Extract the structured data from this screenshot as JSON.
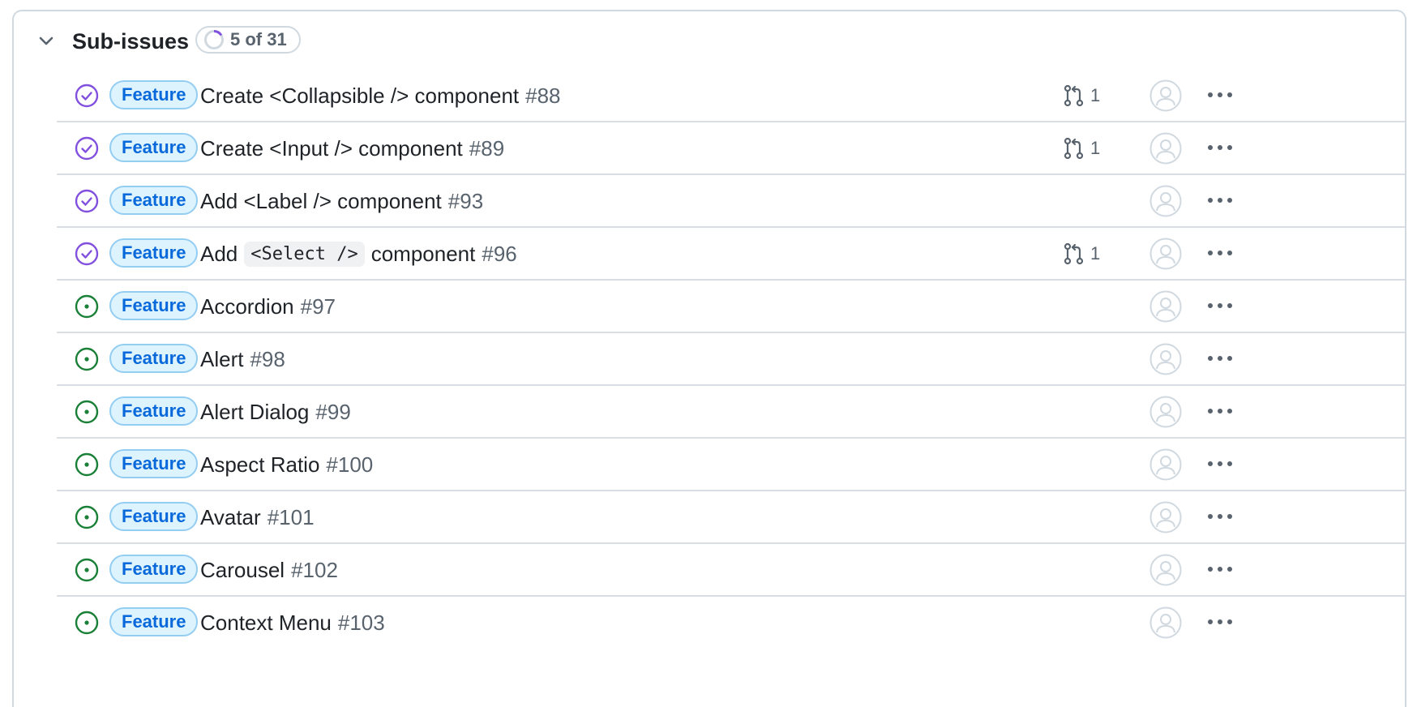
{
  "header": {
    "title": "Sub-issues",
    "progress": "5 of 31",
    "progress_completed": 5,
    "progress_total": 31
  },
  "colors": {
    "closed_purple": "#8250df",
    "open_green": "#1a7f37",
    "label_bg": "#ddf4ff",
    "label_text": "#0969da",
    "muted": "#59636e"
  },
  "rows": [
    {
      "state": "closed",
      "state_icon": "issue-closed-icon",
      "label": "Feature",
      "title": "Create <Collapsible /> component",
      "number": "#88",
      "pr_count": "1",
      "code": ""
    },
    {
      "state": "closed",
      "state_icon": "issue-closed-icon",
      "label": "Feature",
      "title": "Create <Input /> component",
      "number": "#89",
      "pr_count": "1",
      "code": ""
    },
    {
      "state": "closed",
      "state_icon": "issue-closed-icon",
      "label": "Feature",
      "title": "Add <Label /> component",
      "number": "#93",
      "pr_count": "",
      "code": ""
    },
    {
      "state": "closed",
      "state_icon": "issue-closed-icon",
      "label": "Feature",
      "title_before": "Add",
      "code": "<Select />",
      "title_after": "component",
      "number": "#96",
      "pr_count": "1"
    },
    {
      "state": "open",
      "state_icon": "issue-open-icon",
      "label": "Feature",
      "title": "Accordion",
      "number": "#97",
      "pr_count": "",
      "code": ""
    },
    {
      "state": "open",
      "state_icon": "issue-open-icon",
      "label": "Feature",
      "title": "Alert",
      "number": "#98",
      "pr_count": "",
      "code": ""
    },
    {
      "state": "open",
      "state_icon": "issue-open-icon",
      "label": "Feature",
      "title": "Alert Dialog",
      "number": "#99",
      "pr_count": "",
      "code": ""
    },
    {
      "state": "open",
      "state_icon": "issue-open-icon",
      "label": "Feature",
      "title": "Aspect Ratio",
      "number": "#100",
      "pr_count": "",
      "code": ""
    },
    {
      "state": "open",
      "state_icon": "issue-open-icon",
      "label": "Feature",
      "title": "Avatar",
      "number": "#101",
      "pr_count": "",
      "code": ""
    },
    {
      "state": "open",
      "state_icon": "issue-open-icon",
      "label": "Feature",
      "title": "Carousel",
      "number": "#102",
      "pr_count": "",
      "code": ""
    },
    {
      "state": "open",
      "state_icon": "issue-open-icon",
      "label": "Feature",
      "title": "Context Menu",
      "number": "#103",
      "pr_count": "",
      "code": ""
    }
  ]
}
